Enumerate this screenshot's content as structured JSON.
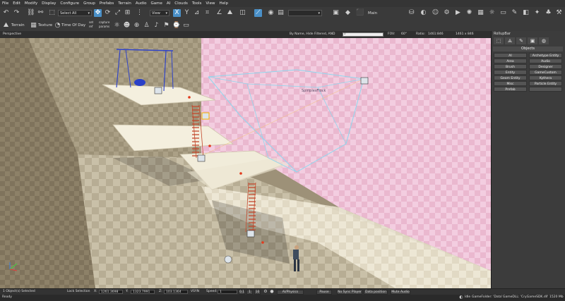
{
  "menu": [
    "File",
    "Edit",
    "Modify",
    "Display",
    "Configure",
    "Group",
    "Prefabs",
    "Terrain",
    "Audio",
    "Game",
    "AI",
    "Clouds",
    "Tools",
    "View",
    "Help"
  ],
  "toolbar1": {
    "select_all": "Select All",
    "view": "View",
    "main_label": "Main"
  },
  "toolbar2": {
    "terrain": "Terrain",
    "texture": "Texture",
    "time_of_day": "Time Of Day",
    "tiny1": "set",
    "tiny2": "ref",
    "tiny3": "capture",
    "tiny4": "params"
  },
  "viewport": {
    "title": "Perspective",
    "filter": "By Name, Hide Filtered, AND",
    "fov_label": "FOV:",
    "fov_value": "60°",
    "ratio_label": "Ratio:",
    "ratio_value": "1461:846",
    "size_value": "1461 x 846",
    "entity_label": "SpiriplesFlock"
  },
  "rollup": {
    "title": "RollupBar",
    "section": "Objects",
    "buttons": [
      "AI",
      "Archetype Entity",
      "Area",
      "Audio",
      "Brush",
      "Designer",
      "Entity",
      "GameCustom",
      "Geom Entity",
      "Kythera",
      "Misc",
      "Particle Entity",
      "Prefab",
      ""
    ]
  },
  "status": {
    "selected": "1 Object(s) Selected",
    "lock_selection": "Lock Selection",
    "x_label": "X:",
    "x_value": "1261.3698",
    "y_label": "Y:",
    "y_value": "1323.7991",
    "z_label": "Z:",
    "z_value": "103.1364",
    "vsnap": "VSYN",
    "speed_label": "Speed:",
    "speed_value": "1",
    "speed_a": "0.1",
    "speed_b": "1",
    "speed_c": "10",
    "ai_physics": "AI/Physics",
    "pause": "Pause",
    "no_sync": "No Sync Player",
    "data_position": "Data position",
    "mute_audio": "Mute Audio",
    "ready": "Ready",
    "idle": "Idle",
    "game_folder": "GameFolder: 'Data'",
    "game_dll": "GameDLL: 'CryGameSDK.dll'",
    "memory": "1520 Mb"
  }
}
